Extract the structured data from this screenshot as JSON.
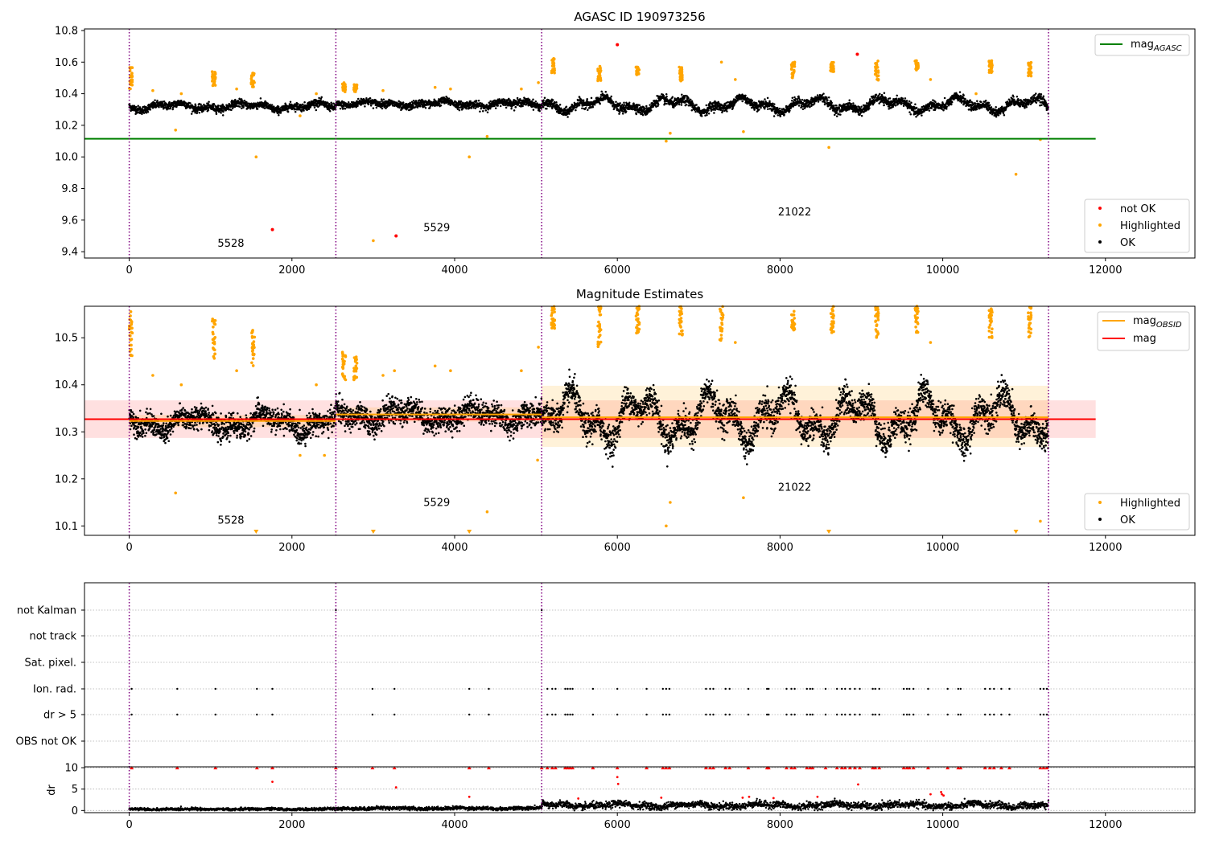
{
  "figure": {
    "background": "#ffffff"
  },
  "colors": {
    "ok": "#000000",
    "highlighted": "#ffa500",
    "not_ok": "#ff0000",
    "mag_agasc": "#008000",
    "mag": "#ff0000",
    "mag_obsid": "#ffa500",
    "obs_boundary": "#800080",
    "grid": "#b0b0b0"
  },
  "chart_data": [
    {
      "type": "scatter",
      "title": "AGASC ID 190973256",
      "xlim": [
        -550,
        13100
      ],
      "ylim": [
        9.36,
        10.81
      ],
      "xticks": [
        0,
        2000,
        4000,
        6000,
        8000,
        10000,
        12000
      ],
      "yticks": [
        9.4,
        9.6,
        9.8,
        10.0,
        10.2,
        10.4,
        10.6,
        10.8
      ],
      "xtick_labels": [
        "0",
        "2000",
        "4000",
        "6000",
        "8000",
        "10000",
        "12000"
      ],
      "ytick_labels": [
        "9.4",
        "9.6",
        "9.8",
        "10.0",
        "10.2",
        "10.4",
        "10.6",
        "10.8"
      ],
      "obs_boundaries": [
        0,
        2540,
        5070,
        11300
      ],
      "obs_labels": [
        {
          "text": "5528",
          "x": 1250,
          "y": 9.43
        },
        {
          "text": "5529",
          "x": 3780,
          "y": 9.53
        },
        {
          "text": "21022",
          "x": 8180,
          "y": 9.63
        }
      ],
      "mag_agasc": {
        "label": "mag",
        "sub": "AGASC",
        "y": 10.115,
        "x": [
          -550,
          11880
        ]
      },
      "legend_lines": [
        {
          "label": "mag",
          "sub": "AGASC",
          "color": "#008000"
        }
      ],
      "legend_markers": [
        {
          "label": "not OK",
          "color": "#ff0000"
        },
        {
          "label": "Highlighted",
          "color": "#ffa500"
        },
        {
          "label": "OK",
          "color": "#000000"
        }
      ],
      "ok_series": [
        {
          "x0": 0,
          "x1": 2540,
          "mean": 10.32,
          "amp": 0.025,
          "spread": 0.012
        },
        {
          "x0": 2540,
          "x1": 5070,
          "mean": 10.335,
          "amp": 0.02,
          "spread": 0.012
        },
        {
          "x0": 5070,
          "x1": 11300,
          "mean": 10.33,
          "amp": 0.05,
          "spread": 0.014
        }
      ],
      "highlighted_clusters": [
        {
          "x": 20,
          "y0": 10.43,
          "y1": 10.57
        },
        {
          "x": 1040,
          "y0": 10.45,
          "y1": 10.54
        },
        {
          "x": 1520,
          "y0": 10.44,
          "y1": 10.53
        },
        {
          "x": 2640,
          "y0": 10.41,
          "y1": 10.47
        },
        {
          "x": 2780,
          "y0": 10.41,
          "y1": 10.46
        },
        {
          "x": 5210,
          "y0": 10.53,
          "y1": 10.63
        },
        {
          "x": 5780,
          "y0": 10.47,
          "y1": 10.58
        },
        {
          "x": 6250,
          "y0": 10.52,
          "y1": 10.57
        },
        {
          "x": 6780,
          "y0": 10.48,
          "y1": 10.57
        },
        {
          "x": 8160,
          "y0": 10.5,
          "y1": 10.6
        },
        {
          "x": 8640,
          "y0": 10.53,
          "y1": 10.6
        },
        {
          "x": 9190,
          "y0": 10.48,
          "y1": 10.61
        },
        {
          "x": 9680,
          "y0": 10.55,
          "y1": 10.61
        },
        {
          "x": 10590,
          "y0": 10.53,
          "y1": 10.62
        },
        {
          "x": 11070,
          "y0": 10.5,
          "y1": 10.6
        }
      ],
      "highlighted_points": [
        [
          570,
          10.17
        ],
        [
          1560,
          10.0
        ],
        [
          4180,
          10.0
        ],
        [
          4400,
          10.13
        ],
        [
          3000,
          9.47
        ],
        [
          2100,
          10.26
        ],
        [
          6600,
          10.1
        ],
        [
          6650,
          10.15
        ],
        [
          7550,
          10.16
        ],
        [
          8600,
          10.06
        ],
        [
          10900,
          9.89
        ],
        [
          11200,
          10.11
        ],
        [
          290,
          10.42
        ],
        [
          640,
          10.4
        ],
        [
          1320,
          10.43
        ],
        [
          2300,
          10.4
        ],
        [
          3120,
          10.42
        ],
        [
          3760,
          10.44
        ],
        [
          3950,
          10.43
        ],
        [
          4820,
          10.43
        ],
        [
          5030,
          10.47
        ],
        [
          7280,
          10.6
        ],
        [
          7450,
          10.49
        ],
        [
          9850,
          10.49
        ],
        [
          10410,
          10.4
        ]
      ],
      "notok_points": [
        [
          1760,
          9.54
        ],
        [
          3280,
          9.5
        ],
        [
          6000,
          10.71
        ],
        [
          8950,
          10.65
        ]
      ]
    },
    {
      "type": "scatter",
      "title": "Magnitude Estimates",
      "xlim": [
        -550,
        13100
      ],
      "ylim": [
        10.08,
        10.567
      ],
      "xticks": [
        0,
        2000,
        4000,
        6000,
        8000,
        10000,
        12000
      ],
      "yticks": [
        10.1,
        10.2,
        10.3,
        10.4,
        10.5
      ],
      "xtick_labels": [
        "0",
        "2000",
        "4000",
        "6000",
        "8000",
        "10000",
        "12000"
      ],
      "ytick_labels": [
        "10.1",
        "10.2",
        "10.3",
        "10.4",
        "10.5"
      ],
      "obs_boundaries": [
        0,
        2540,
        5070,
        11300
      ],
      "obs_labels": [
        {
          "text": "5528",
          "x": 1250,
          "y": 10.105
        },
        {
          "text": "5529",
          "x": 3780,
          "y": 10.142
        },
        {
          "text": "21022",
          "x": 8180,
          "y": 10.175
        }
      ],
      "mag": {
        "label": "mag",
        "y": 10.327,
        "band": [
          10.287,
          10.367
        ],
        "x": [
          -550,
          11880
        ]
      },
      "mag_obsid": [
        {
          "x0": 0,
          "x1": 2540,
          "y": 10.323,
          "band": [
            10.31,
            10.336
          ]
        },
        {
          "x0": 2540,
          "x1": 5070,
          "y": 10.337,
          "band": [
            10.322,
            10.352
          ]
        },
        {
          "x0": 5070,
          "x1": 11300,
          "y": 10.331,
          "band": [
            10.268,
            10.398
          ]
        }
      ],
      "legend_lines": [
        {
          "label": "mag",
          "sub": "OBSID",
          "color": "#ffa500"
        },
        {
          "label": "mag",
          "sub": "",
          "color": "#ff0000"
        }
      ],
      "legend_markers": [
        {
          "label": "Highlighted",
          "color": "#ffa500"
        },
        {
          "label": "OK",
          "color": "#000000"
        }
      ],
      "ok_series": [
        {
          "x0": 0,
          "x1": 2540,
          "mean": 10.32,
          "amp": 0.025,
          "spread": 0.012
        },
        {
          "x0": 2540,
          "x1": 5070,
          "mean": 10.335,
          "amp": 0.022,
          "spread": 0.013
        },
        {
          "x0": 5070,
          "x1": 11300,
          "mean": 10.33,
          "amp": 0.06,
          "spread": 0.016
        }
      ],
      "highlighted_clusters": [
        {
          "x": 20,
          "y0": 10.46,
          "y1": 10.56
        },
        {
          "x": 1040,
          "y0": 10.45,
          "y1": 10.54
        },
        {
          "x": 1520,
          "y0": 10.44,
          "y1": 10.52
        },
        {
          "x": 2640,
          "y0": 10.41,
          "y1": 10.47
        },
        {
          "x": 2780,
          "y0": 10.41,
          "y1": 10.46
        },
        {
          "x": 5210,
          "y0": 10.52,
          "y1": 10.567
        },
        {
          "x": 5780,
          "y0": 10.48,
          "y1": 10.567
        },
        {
          "x": 6250,
          "y0": 10.51,
          "y1": 10.567
        },
        {
          "x": 6780,
          "y0": 10.5,
          "y1": 10.567
        },
        {
          "x": 7280,
          "y0": 10.49,
          "y1": 10.567
        },
        {
          "x": 8160,
          "y0": 10.51,
          "y1": 10.567
        },
        {
          "x": 8640,
          "y0": 10.51,
          "y1": 10.567
        },
        {
          "x": 9190,
          "y0": 10.5,
          "y1": 10.567
        },
        {
          "x": 9680,
          "y0": 10.51,
          "y1": 10.567
        },
        {
          "x": 10590,
          "y0": 10.5,
          "y1": 10.567
        },
        {
          "x": 11070,
          "y0": 10.5,
          "y1": 10.567
        }
      ],
      "highlighted_points": [
        [
          570,
          10.17
        ],
        [
          4400,
          10.13
        ],
        [
          6600,
          10.1
        ],
        [
          6650,
          10.15
        ],
        [
          7550,
          10.16
        ],
        [
          11200,
          10.11
        ],
        [
          290,
          10.42
        ],
        [
          640,
          10.4
        ],
        [
          1320,
          10.43
        ],
        [
          2300,
          10.4
        ],
        [
          2100,
          10.25
        ],
        [
          2400,
          10.25
        ],
        [
          3120,
          10.42
        ],
        [
          3260,
          10.43
        ],
        [
          3760,
          10.44
        ],
        [
          3950,
          10.43
        ],
        [
          4820,
          10.43
        ],
        [
          5030,
          10.48
        ],
        [
          7450,
          10.49
        ],
        [
          9850,
          10.49
        ],
        [
          5020,
          10.24
        ]
      ],
      "down_markers": [
        1560,
        3000,
        4180,
        8600,
        10900
      ]
    },
    {
      "type": "scatter",
      "xlim": [
        -550,
        13100
      ],
      "xticks": [
        0,
        2000,
        4000,
        6000,
        8000,
        10000,
        12000
      ],
      "xtick_labels": [
        "0",
        "2000",
        "4000",
        "6000",
        "8000",
        "10000",
        "12000"
      ],
      "obs_boundaries": [
        0,
        2540,
        5070,
        11300
      ],
      "flag_rows": [
        "not Kalman",
        "not track",
        "Sat. pixel.",
        "Ion. rad.",
        "dr > 5",
        "OBS not OK"
      ],
      "flag_marks": {
        "not Kalman": [
          2540,
          5070
        ],
        "Ion. rad.": [
          30,
          590,
          1060,
          1570,
          1760,
          2990,
          3260,
          4180,
          4420,
          5140,
          5200,
          5240,
          5360,
          5390,
          5420,
          5450,
          5700,
          6000,
          6360,
          6560,
          6600,
          6640,
          7090,
          7140,
          7180,
          7330,
          7380,
          7610,
          7840,
          7860,
          8080,
          8140,
          8180,
          8330,
          8370,
          8400,
          8560,
          8700,
          8760,
          8800,
          8860,
          8920,
          8980,
          9140,
          9170,
          9220,
          9520,
          9560,
          9590,
          9640,
          9820,
          10060,
          10190,
          10220,
          10520,
          10580,
          10630,
          10720,
          10820,
          11200,
          11240,
          11280
        ],
        "dr > 5": [
          30,
          590,
          1060,
          1570,
          1760,
          2990,
          3260,
          4180,
          4420,
          5140,
          5200,
          5240,
          5360,
          5390,
          5420,
          5450,
          5700,
          6000,
          6360,
          6560,
          6600,
          6640,
          7090,
          7140,
          7180,
          7330,
          7380,
          7610,
          7840,
          7860,
          8080,
          8140,
          8180,
          8330,
          8370,
          8400,
          8560,
          8700,
          8760,
          8800,
          8860,
          8920,
          8980,
          9140,
          9170,
          9220,
          9520,
          9560,
          9590,
          9640,
          9820,
          10060,
          10190,
          10220,
          10520,
          10580,
          10630,
          10720,
          10820,
          11200,
          11240,
          11280
        ]
      }
    },
    {
      "type": "scatter",
      "ylabel": "dr",
      "xlim": [
        -550,
        13100
      ],
      "ylim": [
        -0.5,
        10.2
      ],
      "xticks": [
        0,
        2000,
        4000,
        6000,
        8000,
        10000,
        12000
      ],
      "yticks": [
        0,
        5,
        10
      ],
      "xtick_labels": [
        "0",
        "2000",
        "4000",
        "6000",
        "8000",
        "10000",
        "12000"
      ],
      "ytick_labels": [
        "0",
        "5",
        "10"
      ],
      "obs_boundaries": [
        0,
        2540,
        5070,
        11300
      ],
      "ok_series": [
        {
          "x0": 0,
          "x1": 2540,
          "mean": 0.3,
          "amp": 0.1,
          "spread": 0.15
        },
        {
          "x0": 2540,
          "x1": 5070,
          "mean": 0.5,
          "amp": 0.15,
          "spread": 0.2
        },
        {
          "x0": 5070,
          "x1": 11300,
          "mean": 1.2,
          "amp": 0.5,
          "spread": 0.4
        }
      ],
      "clipped_marks": [
        30,
        590,
        1060,
        1570,
        1760,
        2540,
        2990,
        3260,
        4180,
        4420,
        5070,
        5140,
        5200,
        5240,
        5360,
        5390,
        5420,
        5450,
        5700,
        6000,
        6360,
        6560,
        6600,
        6640,
        7090,
        7140,
        7180,
        7330,
        7380,
        7610,
        7840,
        7860,
        8080,
        8140,
        8180,
        8330,
        8370,
        8400,
        8560,
        8700,
        8760,
        8800,
        8860,
        8920,
        8980,
        9140,
        9170,
        9220,
        9520,
        9560,
        9590,
        9640,
        9820,
        10060,
        10190,
        10220,
        10520,
        10580,
        10630,
        10720,
        10820,
        11200,
        11240,
        11280
      ],
      "notok_points": [
        [
          1760,
          6.7
        ],
        [
          3280,
          5.4
        ],
        [
          4180,
          3.2
        ],
        [
          6000,
          7.8
        ],
        [
          6010,
          6.2
        ],
        [
          5520,
          2.8
        ],
        [
          6540,
          3.0
        ],
        [
          7540,
          3.0
        ],
        [
          7620,
          3.2
        ],
        [
          7920,
          2.9
        ],
        [
          8460,
          3.2
        ],
        [
          8960,
          6.1
        ],
        [
          9850,
          3.8
        ],
        [
          9980,
          4.3
        ],
        [
          9990,
          3.8
        ],
        [
          10010,
          3.5
        ]
      ]
    }
  ]
}
